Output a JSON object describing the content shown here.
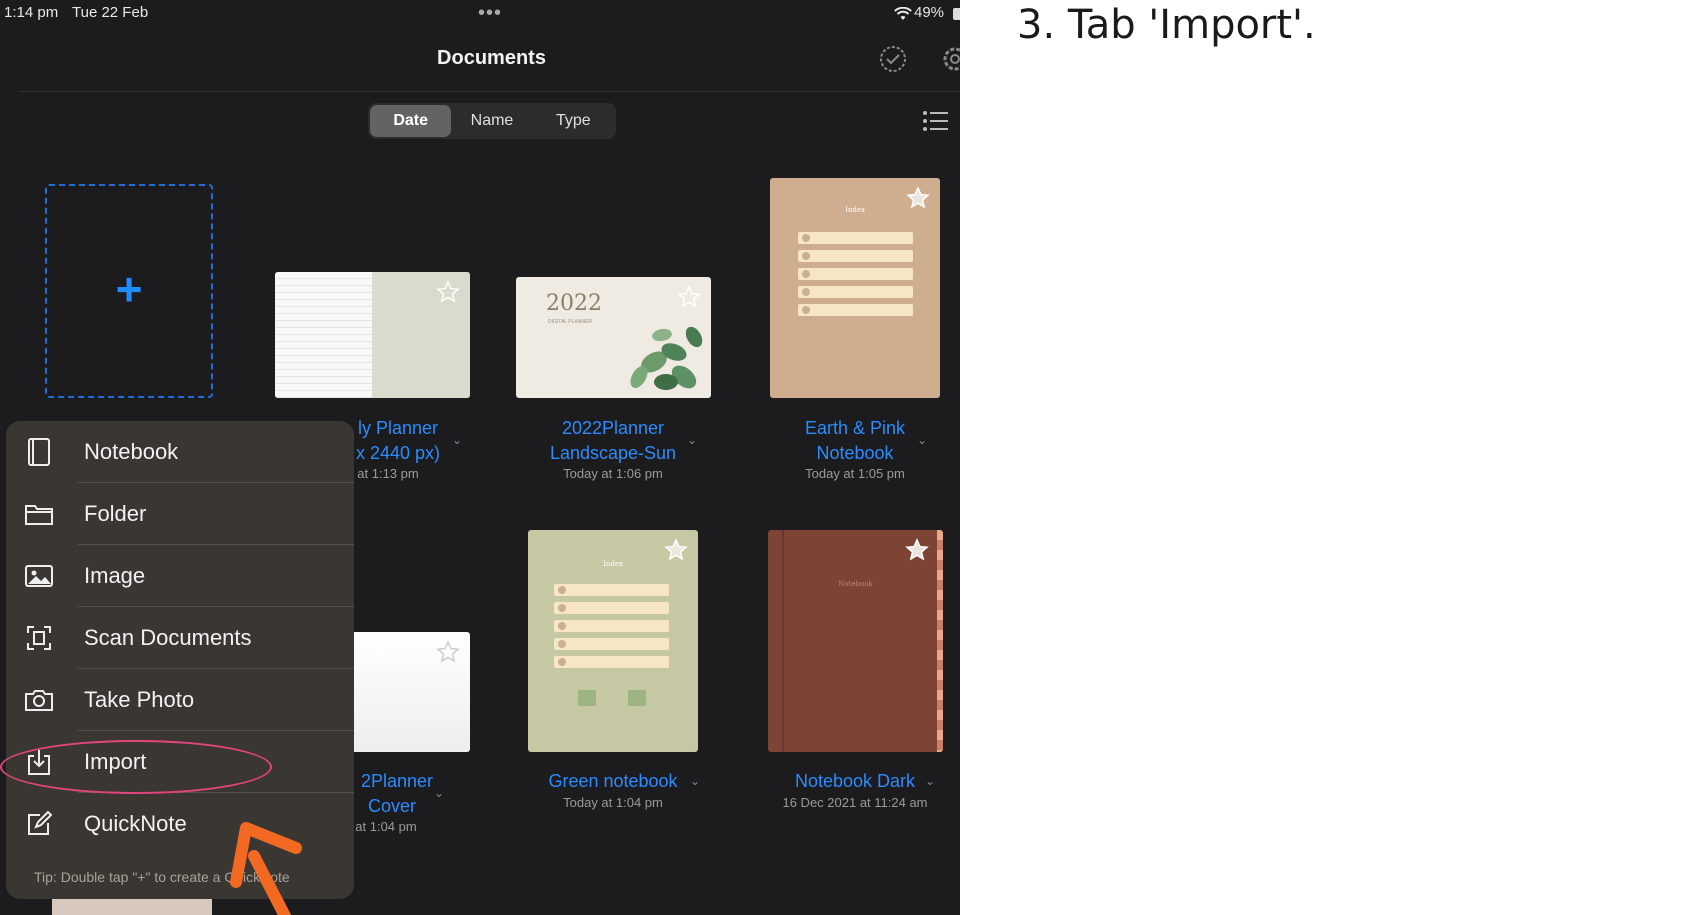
{
  "status_bar": {
    "time": "1:14 pm",
    "date": "Tue 22 Feb",
    "dots": "•••",
    "battery": "49%"
  },
  "nav": {
    "title": "Documents"
  },
  "sort": {
    "options": [
      "Date",
      "Name",
      "Type"
    ],
    "active": "Date"
  },
  "documents": [
    {
      "title_line1": "ly Planner",
      "title_line2": "x 2440 px)",
      "date": "at 1:13 pm"
    },
    {
      "title_line1": "2022Planner",
      "title_line2": "Landscape-Sun",
      "date": "Today at 1:06 pm",
      "cover_text": "2022",
      "cover_sub": "DIGITAL PLANNER"
    },
    {
      "title_line1": "Earth & Pink",
      "title_line2": "Notebook",
      "date": "Today at 1:05 pm",
      "cover_text": "Index"
    },
    {
      "title_line1": "2Planner",
      "title_line2": "Cover",
      "date": "at 1:04 pm"
    },
    {
      "title_line1": "Green notebook",
      "date": "Today at 1:04 pm",
      "cover_text": "Index"
    },
    {
      "title_line1": "Notebook Dark",
      "date": "16 Dec 2021 at 11:24 am",
      "cover_text": "Notebook"
    }
  ],
  "menu": {
    "items": [
      {
        "label": "Notebook",
        "icon": "notebook-icon"
      },
      {
        "label": "Folder",
        "icon": "folder-icon"
      },
      {
        "label": "Image",
        "icon": "image-icon"
      },
      {
        "label": "Scan Documents",
        "icon": "scan-icon"
      },
      {
        "label": "Take Photo",
        "icon": "camera-icon"
      },
      {
        "label": "Import",
        "icon": "import-icon"
      },
      {
        "label": "QuickNote",
        "icon": "quicknote-icon"
      }
    ],
    "tip": "Tip: Double tap \"+\" to create a QuickNote"
  },
  "caption": "3. Tab 'Import'.",
  "colors": {
    "accent": "#2a8cff",
    "highlight": "#e0457b",
    "arrow": "#f26a21",
    "background": "#1c1c1e"
  }
}
